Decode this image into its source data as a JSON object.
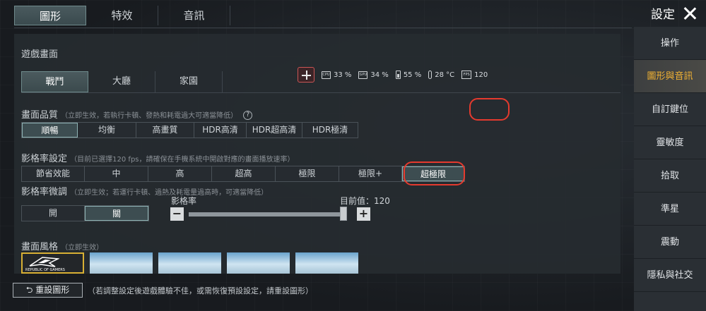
{
  "header": {
    "top_tabs": [
      "圖形",
      "特效",
      "音訊"
    ],
    "title": "設定"
  },
  "game_screen": {
    "title": "遊戲畫面",
    "mode_tabs": [
      "戰鬥",
      "大廳",
      "家園"
    ]
  },
  "quality": {
    "label": "畫面品質",
    "hint": "（立即生效，若執行卡頓、發熱和耗電過大可適當降低）",
    "help": "?",
    "options": [
      "順暢",
      "均衡",
      "高畫質",
      "HDR高清",
      "HDR超高清",
      "HDR極清"
    ],
    "selected": 0
  },
  "status": {
    "cpu": "33 %",
    "gpu": "34 %",
    "battery": "55 %",
    "temp": "28 °C",
    "fps": "120",
    "cpu_icon": "CPU",
    "gpu_icon": "GPU",
    "fps_icon": "FPS"
  },
  "framerate": {
    "label": "影格率設定",
    "hint": "（目前已選擇120 fps，請確保在手機系統中開啟對應的畫面播放速率）",
    "options": [
      "節省效能",
      "中",
      "高",
      "超高",
      "極限",
      "極限+",
      "超極限"
    ],
    "selected": 6
  },
  "fine_tune": {
    "label": "影格率微調",
    "hint": "（立即生效；若運行卡頓、過熱及耗電量過高時，可適當降低）",
    "options": [
      "開",
      "關"
    ],
    "selected": 1,
    "slider_label": "影格率",
    "current_label": "目前值：120",
    "minus": "−",
    "plus": "+",
    "value_fraction": 1.0
  },
  "style": {
    "label": "畫面風格",
    "hint": "（立即生效）",
    "rog_text": "REPUBLIC OF GAMERS"
  },
  "footer": {
    "reset_label": "重設圖形",
    "reset_hint": "（若調整設定後遊戲體驗不佳，或需恢復預設設定，請重設圖形）"
  },
  "sidebar": {
    "items": [
      "操作",
      "圖形與音訊",
      "自訂鍵位",
      "靈敏度",
      "拾取",
      "準星",
      "震動",
      "隱私與社交"
    ],
    "active": 1
  },
  "colors": {
    "highlight_ring": "#e53a2e",
    "active_sidebar_text": "#f2b233"
  }
}
